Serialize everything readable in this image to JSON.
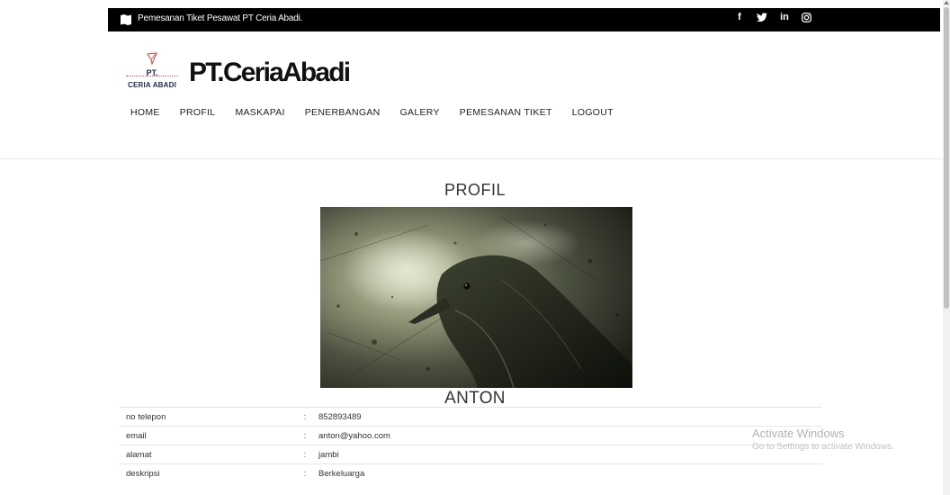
{
  "topbar": {
    "tagline": "Pemesanan Tiket Pesawat PT Ceria Abadi.",
    "socials": [
      {
        "name": "facebook-icon",
        "glyph": "f"
      },
      {
        "name": "twitter-icon",
        "glyph": ""
      },
      {
        "name": "linkedin-icon",
        "glyph": "in"
      },
      {
        "name": "instagram-icon",
        "glyph": ""
      }
    ]
  },
  "header": {
    "logo_top": "PT.",
    "logo_bottom": "CERIA ABADI",
    "brand": "PT.CeriaAbadi"
  },
  "nav": {
    "items": [
      "HOME",
      "PROFIL",
      "MASKAPAI",
      "PENERBANGAN",
      "GALERY",
      "PEMESANAN TIKET",
      "LOGOUT"
    ]
  },
  "profile": {
    "heading": "PROFIL",
    "name": "ANTON",
    "rows": [
      {
        "label": "no telepon",
        "sep": ":",
        "value": "852893489"
      },
      {
        "label": "email",
        "sep": ":",
        "value": "anton@yahoo.com"
      },
      {
        "label": "alamat",
        "sep": ":",
        "value": "jambi"
      },
      {
        "label": "deskripsi",
        "sep": ":",
        "value": "Berkeluarga"
      }
    ]
  },
  "watermark": {
    "title": "Activate Windows",
    "subtitle": "Go to Settings to activate Windows."
  },
  "colors": {
    "topbar_bg": "#000000",
    "page_bg": "#ffffff",
    "logo_navy": "#1e2a4a",
    "logo_red": "#cc4444"
  }
}
